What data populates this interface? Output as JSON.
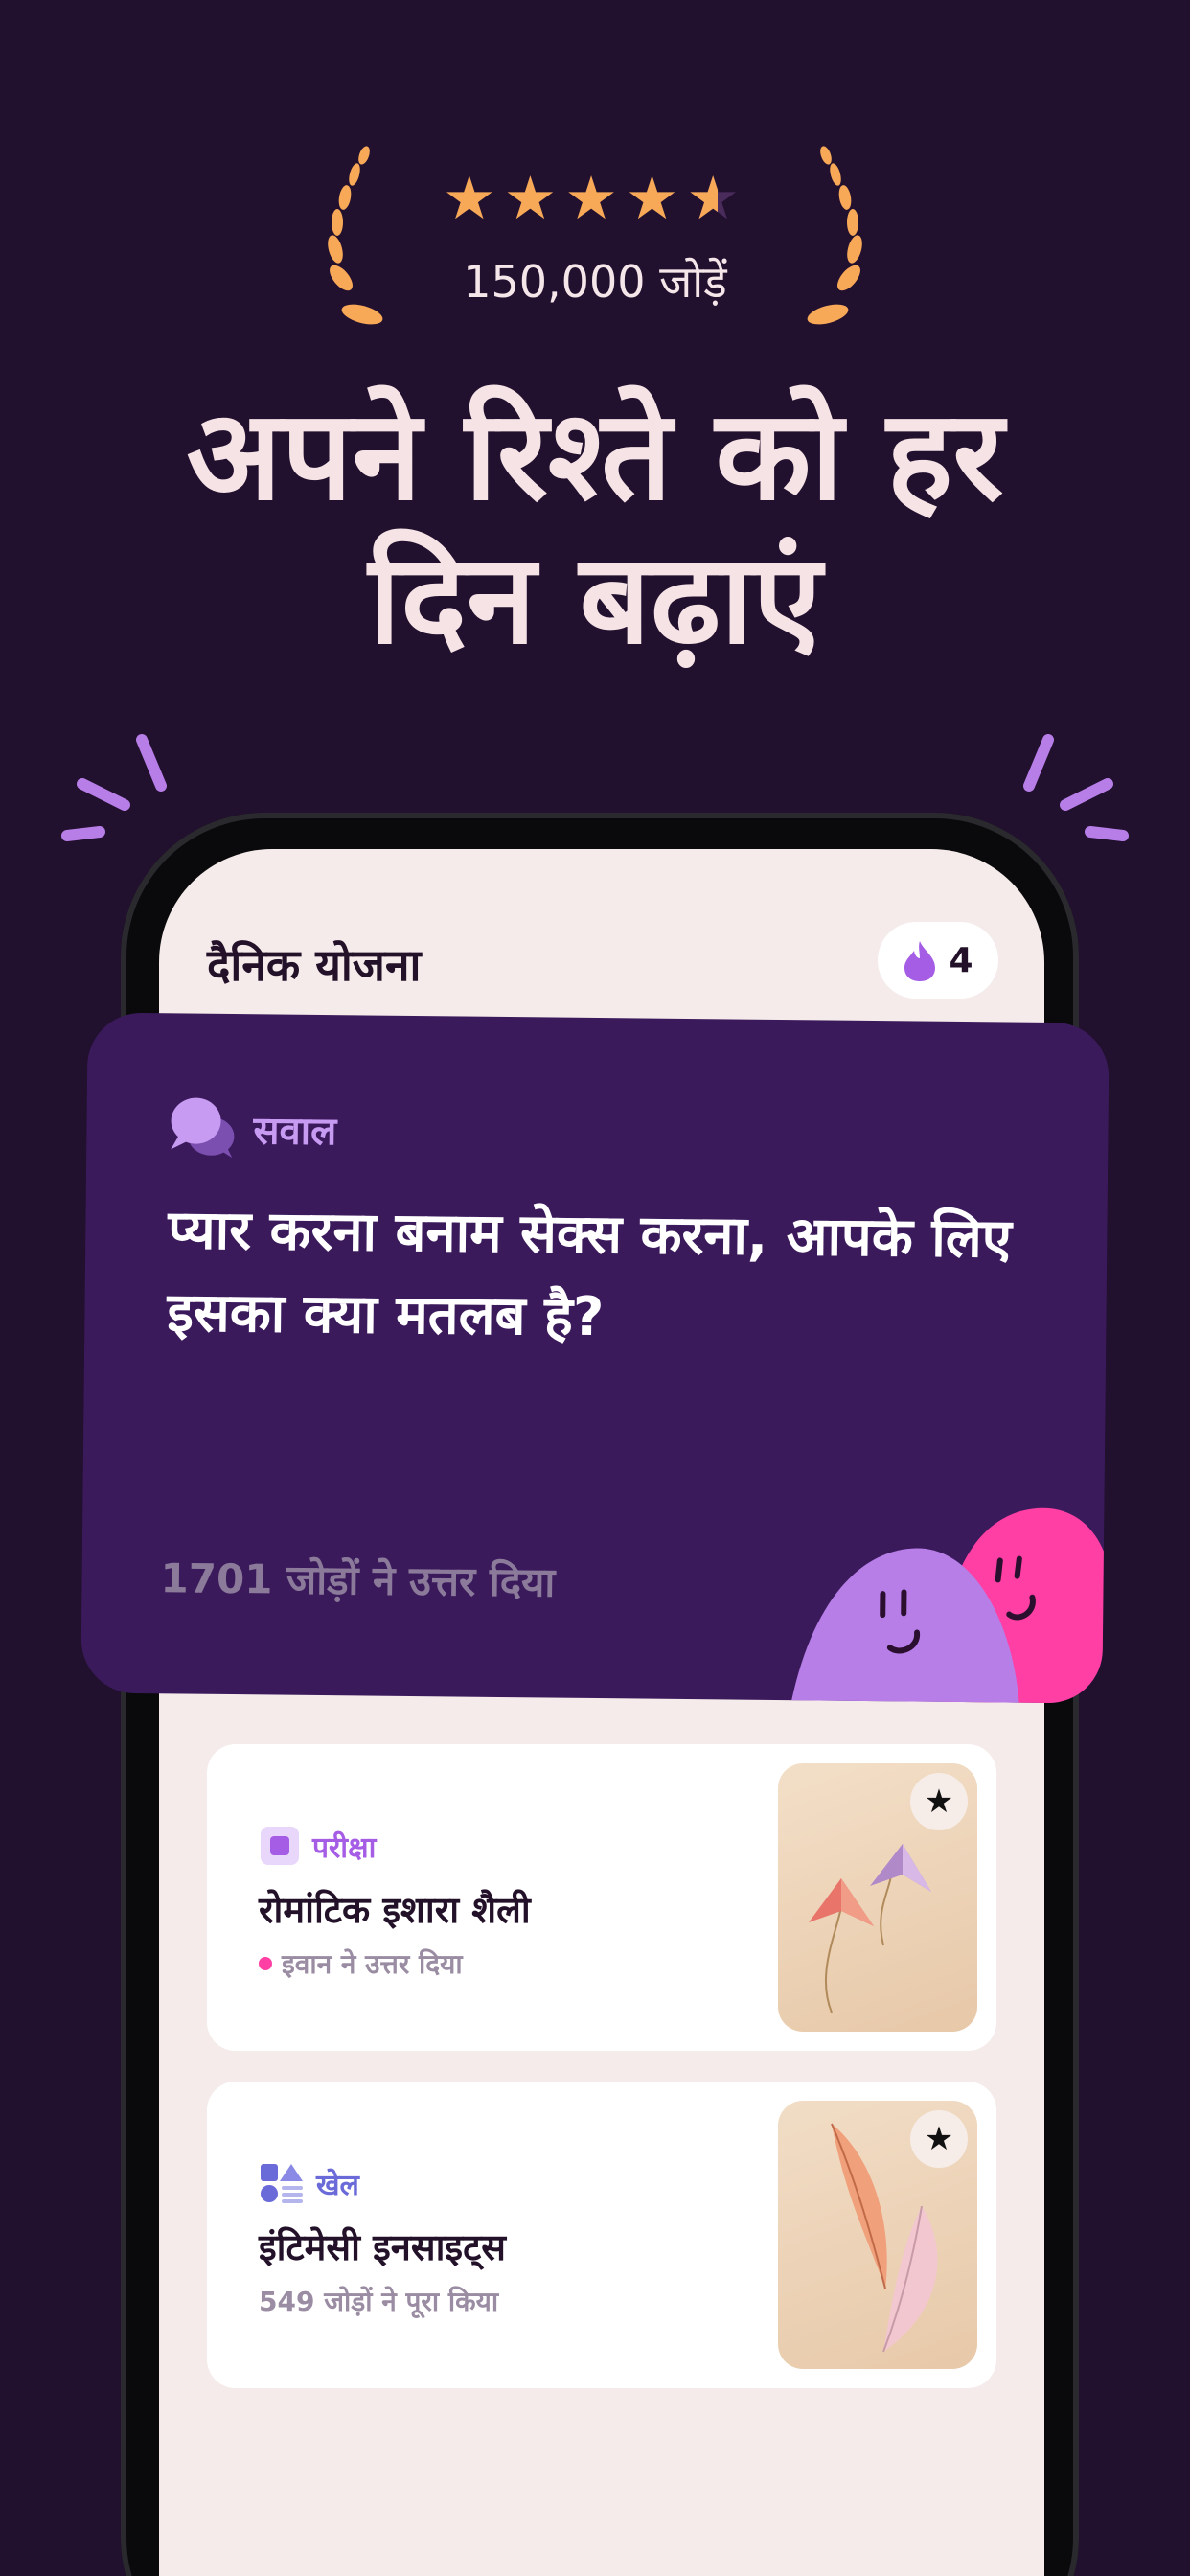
{
  "rating": {
    "stars": "★★★★",
    "half_star": "★",
    "count_label": "150,000 जोड़ें"
  },
  "headline": {
    "line1": "अपने रिश्ते को हर",
    "line2": "दिन बढ़ाएं"
  },
  "app": {
    "header_title": "दैनिक योजना",
    "streak_count": "4",
    "question_card": {
      "tag_label": "सवाल",
      "question": "प्यार करना बनाम सेक्स करना, आपके लिए इसका क्या मतलब है?",
      "answers_label": "1701 जोड़ों ने उत्तर दिया"
    },
    "activities": [
      {
        "tag_label": "परीक्षा",
        "title": "रोमांटिक इशारा शैली",
        "subtitle": "इवान ने उत्तर दिया",
        "favorite_icon": "star-icon"
      },
      {
        "tag_label": "खेल",
        "title": "इंटिमेसी इनसाइट्स",
        "subtitle": "549 जोड़ों ने पूरा किया",
        "favorite_icon": "star-icon"
      }
    ]
  },
  "colors": {
    "background": "#22102f",
    "star": "#f7a957",
    "card_purple": "#3b1a5c",
    "accent_lilac": "#c79bf2",
    "blob_pink": "#ff3fa4",
    "blob_lilac": "#b77ee8"
  }
}
